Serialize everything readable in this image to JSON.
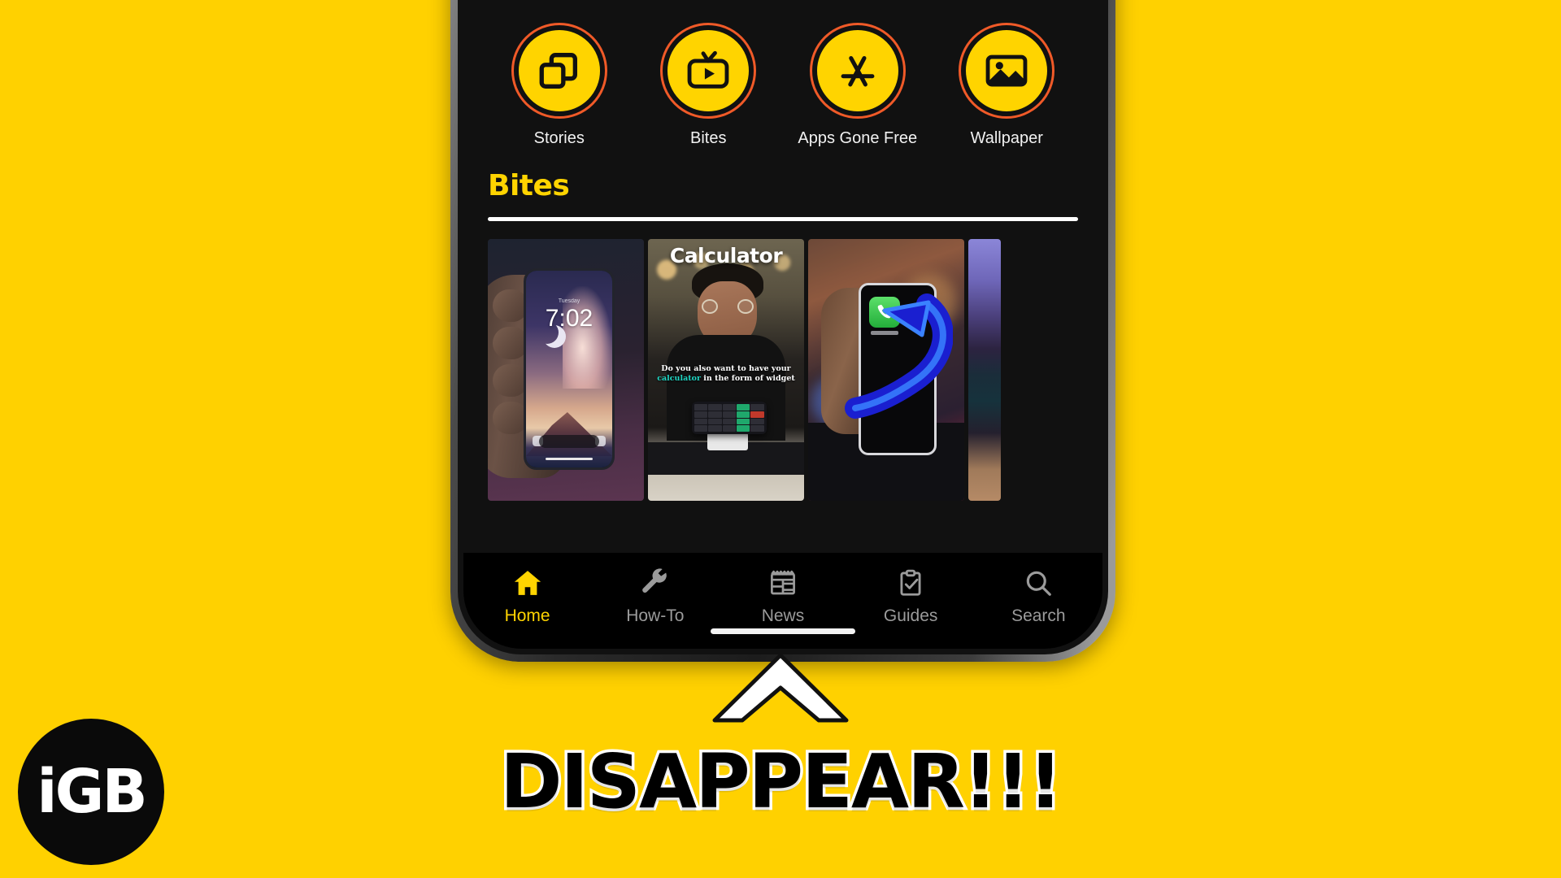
{
  "background_color": "#FFD100",
  "brand": {
    "logo_text": "iGB",
    "logo_bg": "#0a0a0a",
    "logo_fg": "#ffffff"
  },
  "colors": {
    "accent_yellow": "#FFD400",
    "story_ring": "#F05A28",
    "screen_bg": "#111111",
    "tab_inactive": "#9b9b9b",
    "highlight_teal": "#1fd6c3"
  },
  "phone": {
    "stories": [
      {
        "label": "Stories",
        "icon": "stack-squares-icon"
      },
      {
        "label": "Bites",
        "icon": "tv-play-icon"
      },
      {
        "label": "Apps Gone Free",
        "icon": "app-store-icon"
      },
      {
        "label": "Wallpaper",
        "icon": "image-photo-icon"
      }
    ],
    "bites": {
      "title": "Bites",
      "cards": [
        {
          "id": "card-lockscreen",
          "overlay_title": "",
          "time": "7:02",
          "date": "Tuesday",
          "caption": ""
        },
        {
          "id": "card-calculator",
          "overlay_title": "Calculator",
          "caption_line1": "Do you also want to have your",
          "caption_highlight": "calculator",
          "caption_line2": " in the form of widget"
        },
        {
          "id": "card-blue-arrow",
          "overlay_title": "",
          "caption": ""
        },
        {
          "id": "card-partial",
          "overlay_title": "",
          "caption": ""
        }
      ]
    },
    "tabs": [
      {
        "label": "Home",
        "icon": "home-icon",
        "active": true
      },
      {
        "label": "How-To",
        "icon": "wrench-icon",
        "active": false
      },
      {
        "label": "News",
        "icon": "newspaper-icon",
        "active": false
      },
      {
        "label": "Guides",
        "icon": "clipboard-check-icon",
        "active": false
      },
      {
        "label": "Search",
        "icon": "magnifier-icon",
        "active": false
      }
    ],
    "home_indicator": true
  },
  "annotation": {
    "arrow_icon": "chevron-up-icon",
    "headline": "DISAPPEAR!!!"
  }
}
